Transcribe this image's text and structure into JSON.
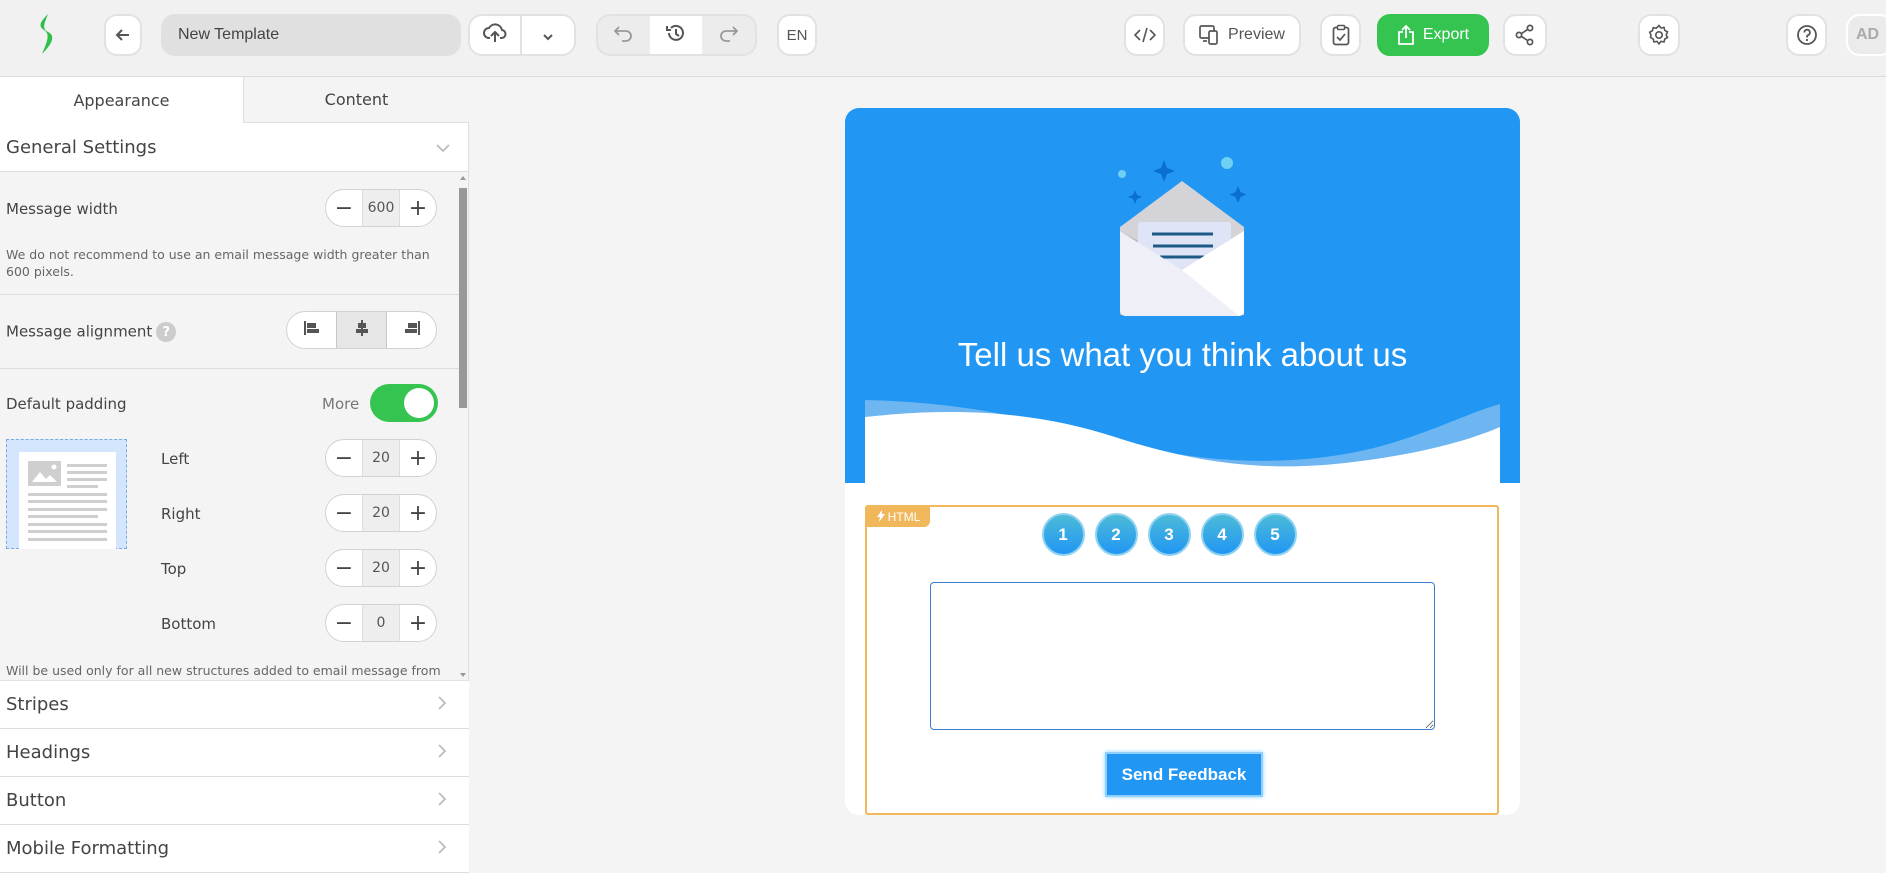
{
  "topbar": {
    "template_name": "New Template",
    "language": "EN",
    "preview_label": "Preview",
    "export_label": "Export",
    "avatar_initials": "AD",
    "icons": {
      "logo": "brand-logo-icon",
      "back": "arrow-left-icon",
      "save": "cloud-upload-icon",
      "save_menu": "chevron-down-icon",
      "undo": "undo-icon",
      "history": "history-icon",
      "redo": "redo-icon",
      "code": "code-icon",
      "preview": "devices-icon",
      "test": "clipboard-check-icon",
      "export": "share-upload-icon",
      "share": "share-icon",
      "settings": "gear-icon",
      "help": "help-icon"
    },
    "colors": {
      "export": "#34c44f",
      "logo": "#2fbf4a"
    }
  },
  "left_panel": {
    "tabs": [
      {
        "label": "Appearance",
        "active": true
      },
      {
        "label": "Content",
        "active": false
      }
    ],
    "general_settings": {
      "title": "General Settings",
      "message_width": {
        "label": "Message width",
        "value": "600",
        "hint": "We do not recommend to use an email message width greater than 600 pixels."
      },
      "message_alignment": {
        "label": "Message alignment",
        "help": "?",
        "options": [
          "left",
          "center",
          "right"
        ],
        "selected": "center"
      },
      "default_padding": {
        "label": "Default padding",
        "more_label": "More",
        "more_enabled": true,
        "fields": [
          {
            "label": "Left",
            "value": "20"
          },
          {
            "label": "Right",
            "value": "20"
          },
          {
            "label": "Top",
            "value": "20"
          },
          {
            "label": "Bottom",
            "value": "0"
          }
        ],
        "hint": "Will be used only for all new structures added to email message from"
      }
    },
    "sections": [
      {
        "label": "Stripes"
      },
      {
        "label": "Headings"
      },
      {
        "label": "Button"
      },
      {
        "label": "Mobile Formatting"
      }
    ]
  },
  "email": {
    "hero_title": "Tell us what you think about us",
    "html_badge": "HTML",
    "ratings": [
      "1",
      "2",
      "3",
      "4",
      "5"
    ],
    "feedback_value": "",
    "send_button": "Send Feedback",
    "colors": {
      "hero": "#2196f3",
      "block_outline": "#f0b75b",
      "button": "#2196f3"
    }
  }
}
